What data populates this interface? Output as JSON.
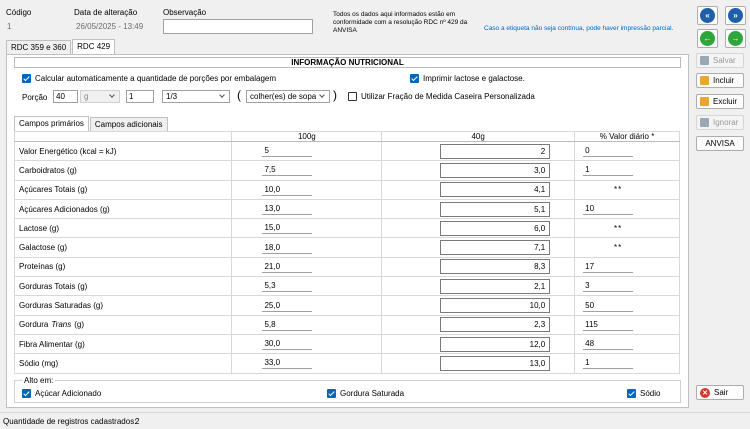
{
  "header": {
    "codigo_label": "Código",
    "codigo_value": "1",
    "data_label": "Data de alteração",
    "data_value": "26/05/2025 - 13:49",
    "obs_label": "Observação",
    "obs_value": "",
    "notice": "Todos os dados aqui informados estão em conformidade com a resolução RDC nº 429 da ANVISA",
    "warning": "Caso a etiqueta não seja contínua, pode haver impressão parcial."
  },
  "top_tabs": [
    "RDC 359 e 360",
    "RDC 429"
  ],
  "panel_title": "INFORMAÇÃO NUTRICIONAL",
  "options": {
    "auto_calc": "Calcular automaticamente a quantidade de porções por embalagem",
    "print_lactose": "Imprimir lactose e galactose.",
    "porcao_label": "Porção",
    "porcao_value": "40",
    "unit_value": "g",
    "qty_value": "1",
    "fraction_value": "1/3",
    "measure_value": "colher(es) de sopa",
    "paren_open": "(",
    "paren_close": ")",
    "custom_fraction": "Utilizar Fração de Medida Caseira Personalizada"
  },
  "inner_tabs": [
    "Campos primários",
    "Campos adicionais"
  ],
  "table": {
    "headers": [
      "100g",
      "40g",
      "% Valor diário *"
    ],
    "rows": [
      {
        "label": "Valor Energético (kcal = kJ)",
        "v100": "5",
        "v40": "2",
        "vd": "0"
      },
      {
        "label": "Carboidratos (g)",
        "v100": "7,5",
        "v40": "3,0",
        "vd": "1"
      },
      {
        "label": "Açúcares Totais (g)",
        "v100": "10,0",
        "v40": "4,1",
        "vd": "**"
      },
      {
        "label": "Açúcares Adicionados (g)",
        "v100": "13,0",
        "v40": "5,1",
        "vd": "10"
      },
      {
        "label": "Lactose (g)",
        "v100": "15,0",
        "v40": "6,0",
        "vd": "**"
      },
      {
        "label": "Galactose (g)",
        "v100": "18,0",
        "v40": "7,1",
        "vd": "**"
      },
      {
        "label": "Proteínas (g)",
        "v100": "21,0",
        "v40": "8,3",
        "vd": "17"
      },
      {
        "label": "Gorduras Totais (g)",
        "v100": "5,3",
        "v40": "2,1",
        "vd": "3"
      },
      {
        "label": "Gorduras Saturadas (g)",
        "v100": "25,0",
        "v40": "10,0",
        "vd": "50"
      },
      {
        "label": "Gordura",
        "label_italic": "Trans",
        "label_suffix": "(g)",
        "v100": "5,8",
        "v40": "2,3",
        "vd": "115"
      },
      {
        "label": "Fibra Alimentar (g)",
        "v100": "30,0",
        "v40": "12,0",
        "vd": "48"
      },
      {
        "label": "Sódio (mg)",
        "v100": "33,0",
        "v40": "13,0",
        "vd": "1"
      }
    ]
  },
  "alto_em": {
    "title": "Alto em:",
    "items": [
      "Açúcar Adicionado",
      "Gordura Saturada",
      "Sódio"
    ]
  },
  "buttons": {
    "salvar": "Salvar",
    "incluir": "Incluir",
    "excluir": "Excluir",
    "ignorar": "Ignorar",
    "anvisa": "ANVISA",
    "sair": "Sair"
  },
  "status": {
    "label": "Quantidade de registros cadastrados:",
    "count": "2"
  },
  "colors": {
    "accent": "#0067c0",
    "nav_blue": "#1f5ea8",
    "nav_green": "#2fa63a",
    "sair_red": "#d23b2a"
  }
}
